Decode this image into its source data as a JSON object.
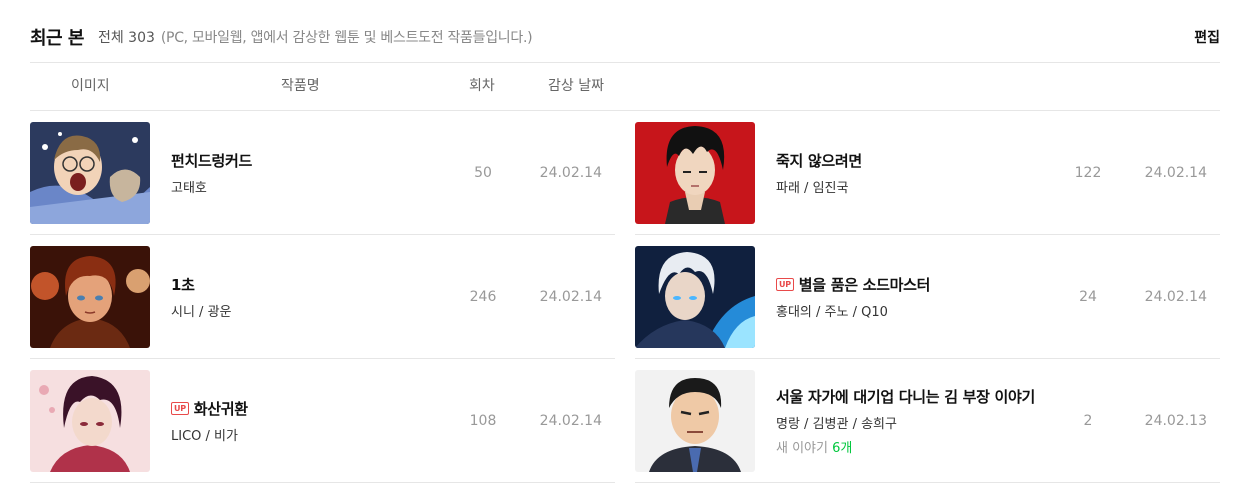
{
  "header": {
    "title": "최근 본",
    "total": "전체 303",
    "description": "(PC, 모바일웹, 앱에서 감상한 웹툰 및 베스트도전 작품들입니다.)",
    "edit_label": "편집"
  },
  "columns": {
    "image": "이미지",
    "title": "작품명",
    "episode": "회차",
    "date": "감상 날짜"
  },
  "up_badge": "UP",
  "items": [
    {
      "title": "펀치드렁커드",
      "author": "고태호",
      "episode": "50",
      "date": "24.02.14",
      "up": false,
      "thumb_icon": "sick-man-in-bed-thumbnail"
    },
    {
      "title": "죽지 않으려면",
      "author": "파래 / 임진국",
      "episode": "122",
      "date": "24.02.14",
      "up": false,
      "thumb_icon": "dark-hair-boy-red-background-thumbnail"
    },
    {
      "title": "1초",
      "author": "시니 / 광운",
      "episode": "246",
      "date": "24.02.14",
      "up": false,
      "thumb_icon": "firefighter-boy-thumbnail"
    },
    {
      "title": "별을 품은 소드마스터",
      "author": "홍대의 / 주노 / Q10",
      "episode": "24",
      "date": "24.02.14",
      "up": true,
      "thumb_icon": "white-hair-swordsman-blue-fire-thumbnail"
    },
    {
      "title": "화산귀환",
      "author": "LICO / 비가",
      "episode": "108",
      "date": "24.02.14",
      "up": true,
      "thumb_icon": "martial-artist-pink-thumbnail"
    },
    {
      "title": "서울 자가에 대기업 다니는 김 부장 이야기",
      "author": "명랑 / 김병관 / 송희구",
      "episode": "2",
      "date": "24.02.13",
      "up": false,
      "new_story_label": "새 이야기",
      "new_story_count": "6개",
      "thumb_icon": "office-manager-suit-thumbnail"
    }
  ],
  "colors": {
    "accent_green": "#00c73c",
    "up_red": "#e84a4a",
    "divider": "#e6e6e6"
  }
}
